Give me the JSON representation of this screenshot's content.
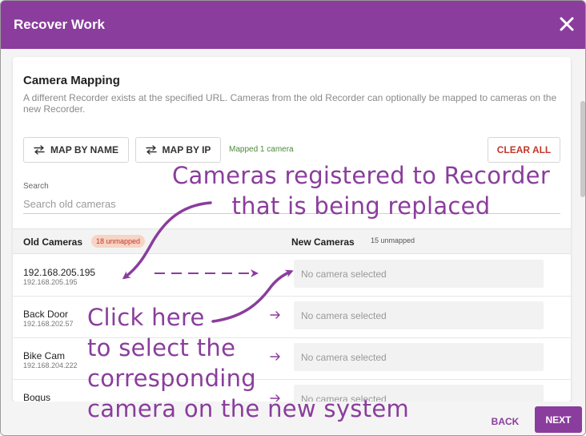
{
  "dialog": {
    "title": "Recover Work"
  },
  "section": {
    "title": "Camera Mapping",
    "description": "A different Recorder exists at the specified URL. Cameras from the old Recorder can optionally be mapped to cameras on the new Recorder."
  },
  "actions": {
    "map_by_name": "MAP BY NAME",
    "map_by_ip": "MAP BY IP",
    "mapped_status": "Mapped 1 camera",
    "clear_all": "CLEAR ALL"
  },
  "search": {
    "label": "Search",
    "placeholder": "Search old cameras"
  },
  "table": {
    "old_header": "Old Cameras",
    "old_badge": "18 unmapped",
    "new_header": "New Cameras",
    "new_badge": "15 unmapped",
    "rows": [
      {
        "name": "192.168.205.195",
        "ip": "192.168.205.195",
        "new_camera": "No camera selected"
      },
      {
        "name": "Back Door",
        "ip": "192.168.202.57",
        "new_camera": "No camera selected"
      },
      {
        "name": "Bike Cam",
        "ip": "192.168.204.222",
        "new_camera": "No camera selected"
      },
      {
        "name": "Bogus",
        "ip": "",
        "new_camera": "No camera selected"
      }
    ]
  },
  "footer": {
    "back": "BACK",
    "next": "NEXT"
  },
  "annotations": {
    "top_line1": "Cameras registered to Recorder",
    "top_line2": "that is being replaced",
    "bottom_line1": "Click here",
    "bottom_line2": "to select the",
    "bottom_line3": "corresponding",
    "bottom_line4": "camera on the  new system"
  },
  "colors": {
    "brand": "#8a3d9c",
    "danger": "#c0392b",
    "success": "#4c8a3a"
  },
  "icons": {
    "close": "close-icon",
    "swap": "swap-arrows-icon",
    "row_arrow": "arrow-right-icon"
  }
}
